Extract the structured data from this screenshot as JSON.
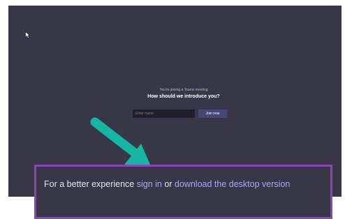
{
  "meeting": {
    "joining_text": "You're joining a Teams meeting",
    "intro_heading": "How should we introduce you?",
    "name_input": {
      "placeholder": "Enter name",
      "value": ""
    },
    "join_button": "Join now"
  },
  "banner": {
    "prefix": "For a better experience ",
    "sign_in_link": "sign in",
    "separator": " or ",
    "desktop_link": "download the desktop version"
  },
  "colors": {
    "meeting_background": "#383748",
    "input_background": "#1f1e2a",
    "join_button_background": "#464775",
    "link_color": "#a8a6ff",
    "highlight_border": "#8c45b6",
    "arrow": "#16b7a2"
  },
  "icons": {
    "cursor": "pointer-cursor-icon",
    "arrow": "down-left-arrow-icon"
  }
}
